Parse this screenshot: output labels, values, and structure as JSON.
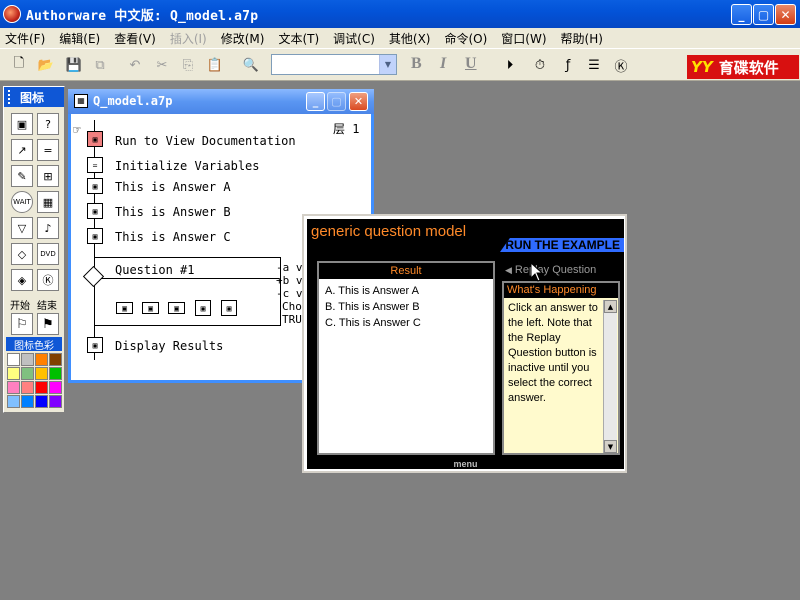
{
  "window": {
    "title": "Authorware 中文版: Q_model.a7p",
    "minimize": "_",
    "maximize": "▢",
    "close": "✕"
  },
  "menubar": {
    "items": [
      {
        "label": "文件(F)",
        "enabled": true
      },
      {
        "label": "编辑(E)",
        "enabled": true
      },
      {
        "label": "查看(V)",
        "enabled": true
      },
      {
        "label": "插入(I)",
        "enabled": false
      },
      {
        "label": "修改(M)",
        "enabled": true
      },
      {
        "label": "文本(T)",
        "enabled": true
      },
      {
        "label": "调试(C)",
        "enabled": true
      },
      {
        "label": "其他(X)",
        "enabled": true
      },
      {
        "label": "命令(O)",
        "enabled": true
      },
      {
        "label": "窗口(W)",
        "enabled": true
      },
      {
        "label": "帮助(H)",
        "enabled": true
      }
    ]
  },
  "toolbar": {
    "style_value": "",
    "bold_label": "B",
    "italic_label": "I",
    "underline_label": "U",
    "brand_text": "育碟软件",
    "brand_mark": "YY"
  },
  "palette": {
    "title": "图标",
    "start_label": "开始",
    "end_label": "结束",
    "color_title": "图标色彩",
    "icons": [
      "display-icon",
      "question-icon",
      "motion-icon",
      "erase-icon",
      "edit-icon",
      "calc-icon",
      "wait-icon",
      "navigate-icon",
      "framework-icon",
      "decision-icon",
      "interaction-icon",
      "video-icon",
      "sound-icon",
      "dvd-icon",
      "map-icon",
      "knowledge-object-icon"
    ],
    "swatch_colors": [
      "#ffffff",
      "#c0c0c0",
      "#ff8000",
      "#804000",
      "#ffff80",
      "#80c080",
      "#ffc000",
      "#00c000",
      "#ff80c0",
      "#ff8080",
      "#ff0000",
      "#ff00ff",
      "#80c0ff",
      "#0080ff",
      "#0000ff",
      "#8000ff"
    ]
  },
  "flow_window": {
    "title": "Q_model.a7p",
    "level_label": "层 1",
    "nodes": [
      {
        "label": "Run to View Documentation"
      },
      {
        "label": "Initialize Variables"
      },
      {
        "label": "This is Answer A"
      },
      {
        "label": "This is Answer B"
      },
      {
        "label": "This is Answer C"
      },
      {
        "label": "Question #1"
      },
      {
        "label": "Display Results"
      }
    ],
    "side_text": [
      "-a v",
      "+b v",
      "-c v",
      "Cho",
      "TRU"
    ]
  },
  "presentation": {
    "title": "generic question model",
    "run_label": "RUN THE EXAMPLE",
    "result_header": "Result",
    "answers": [
      "A.  This is Answer A",
      "B.  This is Answer B",
      "C.  This is Answer C"
    ],
    "replay_label": "Replay Question",
    "whats_header": "What's Happening",
    "whats_text": "Click an answer to the left. Note that the Replay Question button is inactive until you select the correct answer.",
    "menu_label": "menu"
  }
}
